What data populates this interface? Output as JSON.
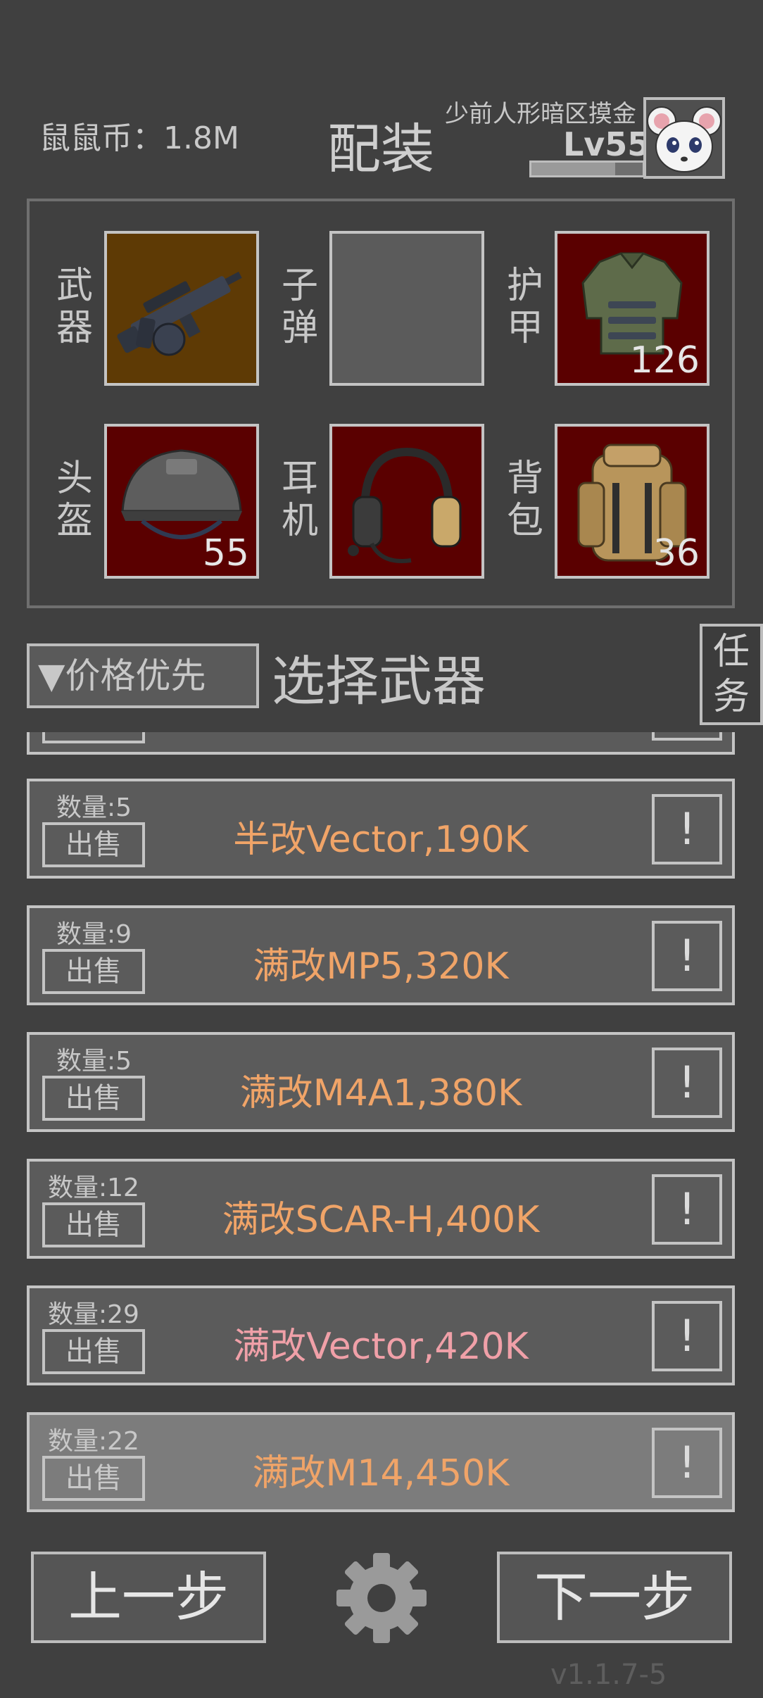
{
  "header": {
    "coins": "鼠鼠币：1.8M",
    "title": "配装",
    "player_name": "少前人形暗区摸金",
    "level": "Lv55",
    "xp_fraction": 0.75
  },
  "equipment": {
    "slots": [
      {
        "label": "武器",
        "count": ""
      },
      {
        "label": "子弹",
        "count": ""
      },
      {
        "label": "护甲",
        "count": "126"
      },
      {
        "label": "头盔",
        "count": "55"
      },
      {
        "label": "耳机",
        "count": ""
      },
      {
        "label": "背包",
        "count": "36"
      }
    ]
  },
  "toolbar": {
    "sort_label": "▼价格优先",
    "select_title": "选择武器",
    "task_label": "任务"
  },
  "list": {
    "sell_label": "出售",
    "info_label": "!",
    "items": [
      {
        "qty": "数量:5",
        "name": "半改Vector,190K",
        "color": "#f0a468"
      },
      {
        "qty": "数量:9",
        "name": "满改MP5,320K",
        "color": "#f0a468"
      },
      {
        "qty": "数量:5",
        "name": "满改M4A1,380K",
        "color": "#f0a468"
      },
      {
        "qty": "数量:12",
        "name": "满改SCAR-H,400K",
        "color": "#f0a468"
      },
      {
        "qty": "数量:29",
        "name": "满改Vector,420K",
        "color": "#f0a0a8"
      },
      {
        "qty": "数量:22",
        "name": "满改M14,450K",
        "color": "#f0a468"
      }
    ]
  },
  "footer": {
    "prev_label": "上一步",
    "next_label": "下一步",
    "version": "v1.1.7-5"
  }
}
